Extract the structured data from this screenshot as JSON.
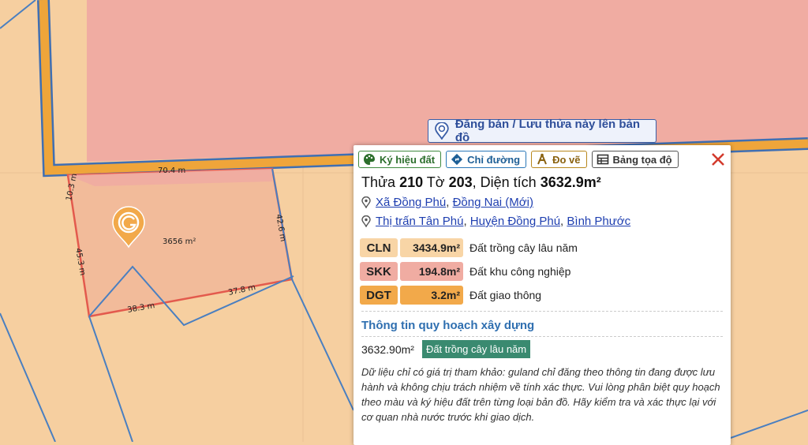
{
  "map": {
    "edge_labels": [
      "70.4 m",
      "10.3 m",
      "42.6 m",
      "45.3 m",
      "37.8 m",
      "38.3 m"
    ],
    "area_label": "3656 m²",
    "pin_icon": "guland-pin-icon",
    "colors": {
      "background": "#f6cfa0",
      "industrial_zone": "#f0aca2",
      "parcel_fill": "#f2bb9a",
      "parcel_border": "#e35a4d",
      "road": "#efa53a",
      "road_border": "#3f6fb3",
      "boundary": "#4a7fc0"
    }
  },
  "cta": {
    "label": "Đăng bán / Lưu thửa này lên bản đồ",
    "icon": "map-pin-icon"
  },
  "popup": {
    "toolbar": [
      {
        "label": "Ký hiệu đất",
        "icon": "palette-icon"
      },
      {
        "label": "Chỉ đường",
        "icon": "direction-icon"
      },
      {
        "label": "Đo vẽ",
        "icon": "measure-icon"
      },
      {
        "label": "Bảng tọa độ",
        "icon": "table-icon"
      }
    ],
    "close_icon": "close-icon",
    "title": {
      "prefix": "Thửa ",
      "parcel": "210",
      "mid": " Tờ ",
      "sheet": "203",
      "area_prefix": ", Diện tích ",
      "area": "3632.9m²"
    },
    "address_new": {
      "ward": "Xã Đồng Phú",
      "province": "Đồng Nai (Mới)"
    },
    "address_old": {
      "town": "Thị trấn Tân Phú",
      "district": "Huyện Đồng Phú",
      "province": "Bình Phước"
    },
    "land_uses": [
      {
        "code": "CLN",
        "area": "3434.9m²",
        "desc": "Đất trồng cây lâu năm",
        "code_color": "#f8d5a6",
        "area_color": "#f8d5a6"
      },
      {
        "code": "SKK",
        "area": "194.8m²",
        "desc": "Đất khu công nghiệp",
        "code_color": "#f0aca2",
        "area_color": "#f0aca2"
      },
      {
        "code": "DGT",
        "area": "3.2m²",
        "desc": "Đất giao thông",
        "code_color": "#f2a94a",
        "area_color": "#f2a94a"
      }
    ],
    "plan": {
      "heading": "Thông tin quy hoạch xây dựng",
      "area": "3632.90m²",
      "tag": "Đất trồng cây lâu năm"
    },
    "disclaimer": "Dữ liệu chỉ có giá trị tham khảo: guland chỉ đăng theo thông tin đang được lưu hành và không chịu trách nhiệm về tính xác thực. Vui lòng phân biệt quy hoạch theo màu và ký hiệu đất trên từng loại bản đồ. Hãy kiểm tra và xác thực lại với cơ quan nhà nước trước khi giao dịch."
  }
}
